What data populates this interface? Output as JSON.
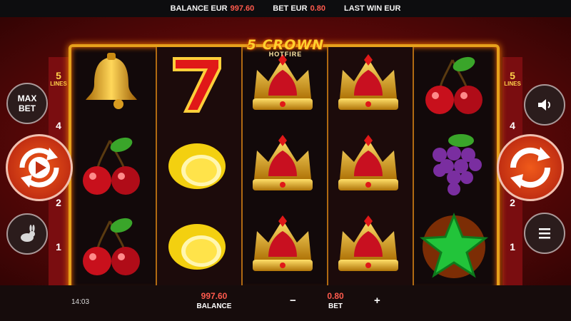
{
  "top_bar": {
    "balance_label": "BALANCE EUR",
    "balance_value": "997.60",
    "bet_label": "BET EUR",
    "bet_value": "0.80",
    "last_win_label": "LAST WIN EUR"
  },
  "logo": {
    "title": "5 CROWN",
    "subtitle": "HOTFIRE"
  },
  "left_panel": {
    "lines_count": "5",
    "lines_label": "LINES",
    "line_numbers": [
      "4",
      "2",
      "1"
    ]
  },
  "right_panel": {
    "lines_count": "5",
    "lines_label": "LINES",
    "line_numbers": [
      "4",
      "2",
      "1"
    ]
  },
  "buttons": {
    "max_bet_line1": "MAX",
    "max_bet_line2": "BET"
  },
  "reels": [
    [
      "bell",
      "cherry",
      "cherry"
    ],
    [
      "seven",
      "lemon",
      "lemon"
    ],
    [
      "crown",
      "crown",
      "crown"
    ],
    [
      "crown",
      "crown",
      "crown"
    ],
    [
      "cherry",
      "grapes",
      "star"
    ]
  ],
  "icons": {
    "max_bet": "max-bet-button",
    "autoplay_left": "autoplay-spin-icon",
    "turbo": "rabbit-icon",
    "sound": "speaker-icon",
    "spin_right": "spin-icon",
    "menu": "hamburger-menu-icon"
  },
  "bottom_bar": {
    "time": "14:03",
    "balance_value": "997.60",
    "balance_label": "BALANCE",
    "bet_value": "0.80",
    "bet_label": "BET",
    "minus": "−",
    "plus": "+"
  },
  "colors": {
    "accent_red": "#ff5a4d",
    "frame_gold": "#e6a11c",
    "background": "#5c0808"
  }
}
